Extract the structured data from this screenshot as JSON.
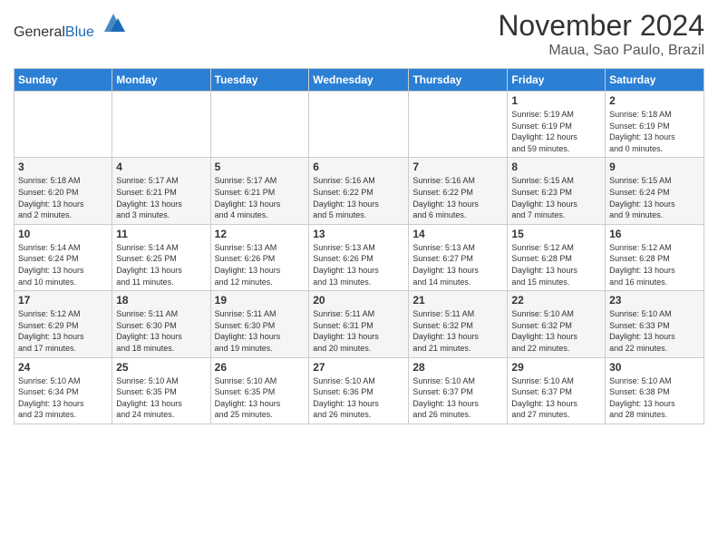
{
  "header": {
    "logo_general": "General",
    "logo_blue": "Blue",
    "month_title": "November 2024",
    "location": "Maua, Sao Paulo, Brazil"
  },
  "weekdays": [
    "Sunday",
    "Monday",
    "Tuesday",
    "Wednesday",
    "Thursday",
    "Friday",
    "Saturday"
  ],
  "weeks": [
    {
      "days": [
        {
          "num": "",
          "detail": ""
        },
        {
          "num": "",
          "detail": ""
        },
        {
          "num": "",
          "detail": ""
        },
        {
          "num": "",
          "detail": ""
        },
        {
          "num": "",
          "detail": ""
        },
        {
          "num": "1",
          "detail": "Sunrise: 5:19 AM\nSunset: 6:19 PM\nDaylight: 12 hours\nand 59 minutes."
        },
        {
          "num": "2",
          "detail": "Sunrise: 5:18 AM\nSunset: 6:19 PM\nDaylight: 13 hours\nand 0 minutes."
        }
      ]
    },
    {
      "days": [
        {
          "num": "3",
          "detail": "Sunrise: 5:18 AM\nSunset: 6:20 PM\nDaylight: 13 hours\nand 2 minutes."
        },
        {
          "num": "4",
          "detail": "Sunrise: 5:17 AM\nSunset: 6:21 PM\nDaylight: 13 hours\nand 3 minutes."
        },
        {
          "num": "5",
          "detail": "Sunrise: 5:17 AM\nSunset: 6:21 PM\nDaylight: 13 hours\nand 4 minutes."
        },
        {
          "num": "6",
          "detail": "Sunrise: 5:16 AM\nSunset: 6:22 PM\nDaylight: 13 hours\nand 5 minutes."
        },
        {
          "num": "7",
          "detail": "Sunrise: 5:16 AM\nSunset: 6:22 PM\nDaylight: 13 hours\nand 6 minutes."
        },
        {
          "num": "8",
          "detail": "Sunrise: 5:15 AM\nSunset: 6:23 PM\nDaylight: 13 hours\nand 7 minutes."
        },
        {
          "num": "9",
          "detail": "Sunrise: 5:15 AM\nSunset: 6:24 PM\nDaylight: 13 hours\nand 9 minutes."
        }
      ]
    },
    {
      "days": [
        {
          "num": "10",
          "detail": "Sunrise: 5:14 AM\nSunset: 6:24 PM\nDaylight: 13 hours\nand 10 minutes."
        },
        {
          "num": "11",
          "detail": "Sunrise: 5:14 AM\nSunset: 6:25 PM\nDaylight: 13 hours\nand 11 minutes."
        },
        {
          "num": "12",
          "detail": "Sunrise: 5:13 AM\nSunset: 6:26 PM\nDaylight: 13 hours\nand 12 minutes."
        },
        {
          "num": "13",
          "detail": "Sunrise: 5:13 AM\nSunset: 6:26 PM\nDaylight: 13 hours\nand 13 minutes."
        },
        {
          "num": "14",
          "detail": "Sunrise: 5:13 AM\nSunset: 6:27 PM\nDaylight: 13 hours\nand 14 minutes."
        },
        {
          "num": "15",
          "detail": "Sunrise: 5:12 AM\nSunset: 6:28 PM\nDaylight: 13 hours\nand 15 minutes."
        },
        {
          "num": "16",
          "detail": "Sunrise: 5:12 AM\nSunset: 6:28 PM\nDaylight: 13 hours\nand 16 minutes."
        }
      ]
    },
    {
      "days": [
        {
          "num": "17",
          "detail": "Sunrise: 5:12 AM\nSunset: 6:29 PM\nDaylight: 13 hours\nand 17 minutes."
        },
        {
          "num": "18",
          "detail": "Sunrise: 5:11 AM\nSunset: 6:30 PM\nDaylight: 13 hours\nand 18 minutes."
        },
        {
          "num": "19",
          "detail": "Sunrise: 5:11 AM\nSunset: 6:30 PM\nDaylight: 13 hours\nand 19 minutes."
        },
        {
          "num": "20",
          "detail": "Sunrise: 5:11 AM\nSunset: 6:31 PM\nDaylight: 13 hours\nand 20 minutes."
        },
        {
          "num": "21",
          "detail": "Sunrise: 5:11 AM\nSunset: 6:32 PM\nDaylight: 13 hours\nand 21 minutes."
        },
        {
          "num": "22",
          "detail": "Sunrise: 5:10 AM\nSunset: 6:32 PM\nDaylight: 13 hours\nand 22 minutes."
        },
        {
          "num": "23",
          "detail": "Sunrise: 5:10 AM\nSunset: 6:33 PM\nDaylight: 13 hours\nand 22 minutes."
        }
      ]
    },
    {
      "days": [
        {
          "num": "24",
          "detail": "Sunrise: 5:10 AM\nSunset: 6:34 PM\nDaylight: 13 hours\nand 23 minutes."
        },
        {
          "num": "25",
          "detail": "Sunrise: 5:10 AM\nSunset: 6:35 PM\nDaylight: 13 hours\nand 24 minutes."
        },
        {
          "num": "26",
          "detail": "Sunrise: 5:10 AM\nSunset: 6:35 PM\nDaylight: 13 hours\nand 25 minutes."
        },
        {
          "num": "27",
          "detail": "Sunrise: 5:10 AM\nSunset: 6:36 PM\nDaylight: 13 hours\nand 26 minutes."
        },
        {
          "num": "28",
          "detail": "Sunrise: 5:10 AM\nSunset: 6:37 PM\nDaylight: 13 hours\nand 26 minutes."
        },
        {
          "num": "29",
          "detail": "Sunrise: 5:10 AM\nSunset: 6:37 PM\nDaylight: 13 hours\nand 27 minutes."
        },
        {
          "num": "30",
          "detail": "Sunrise: 5:10 AM\nSunset: 6:38 PM\nDaylight: 13 hours\nand 28 minutes."
        }
      ]
    }
  ]
}
